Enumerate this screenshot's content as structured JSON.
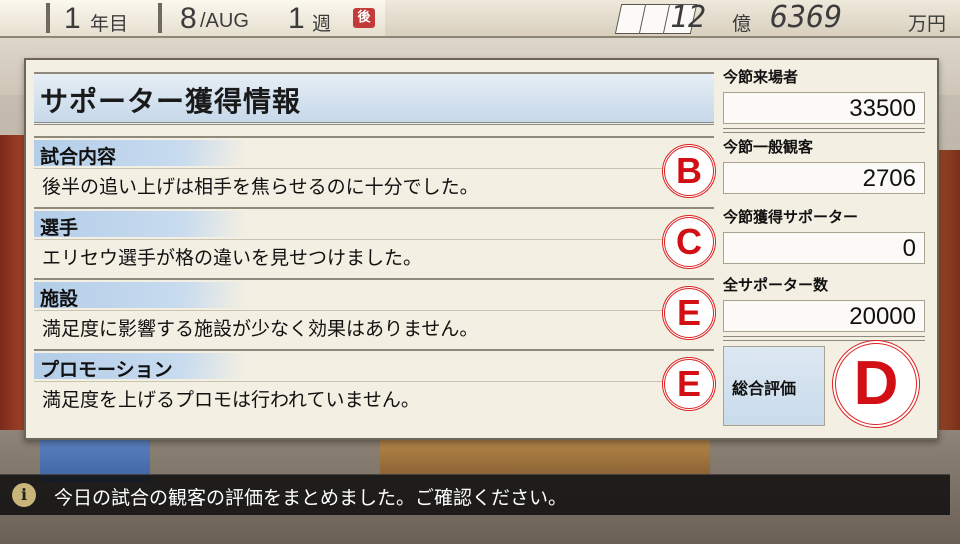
{
  "header": {
    "year_num": "1",
    "year_label": "年目",
    "month_num": "8",
    "month_label": "/AUG",
    "week_num": "1",
    "week_label": "週",
    "rank_badge": "後",
    "money_oku": "12",
    "money_oku_label": "億",
    "money_man": "6369",
    "money_unit": "万円"
  },
  "panel": {
    "title": "サポーター獲得情報",
    "rows": [
      {
        "label": "試合内容",
        "text": "後半の追い上げは相手を焦らせるのに十分でした。",
        "grade": "B"
      },
      {
        "label": "選手",
        "text": "エリセウ選手が格の違いを見せつけました。",
        "grade": "C"
      },
      {
        "label": "施設",
        "text": "満足度に影響する施設が少なく効果はありません。",
        "grade": "E"
      },
      {
        "label": "プロモーション",
        "text": "満足度を上げるプロモは行われていません。",
        "grade": "E"
      }
    ],
    "stats": [
      {
        "label": "今節来場者",
        "value": "33500"
      },
      {
        "label": "今節一般観客",
        "value": "2706"
      },
      {
        "label": "今節獲得サポーター",
        "value": "0"
      },
      {
        "label": "全サポーター数",
        "value": "20000"
      }
    ],
    "total_label": "総合評価",
    "total_grade": "D"
  },
  "message": {
    "icon": "info-icon",
    "text": "今日の試合の観客の評価をまとめました。ご確認ください。"
  },
  "colors": {
    "grade_red": "#d10f14",
    "label_band_blue": "#b3cde8",
    "panel_bg": "#f3efe2"
  }
}
